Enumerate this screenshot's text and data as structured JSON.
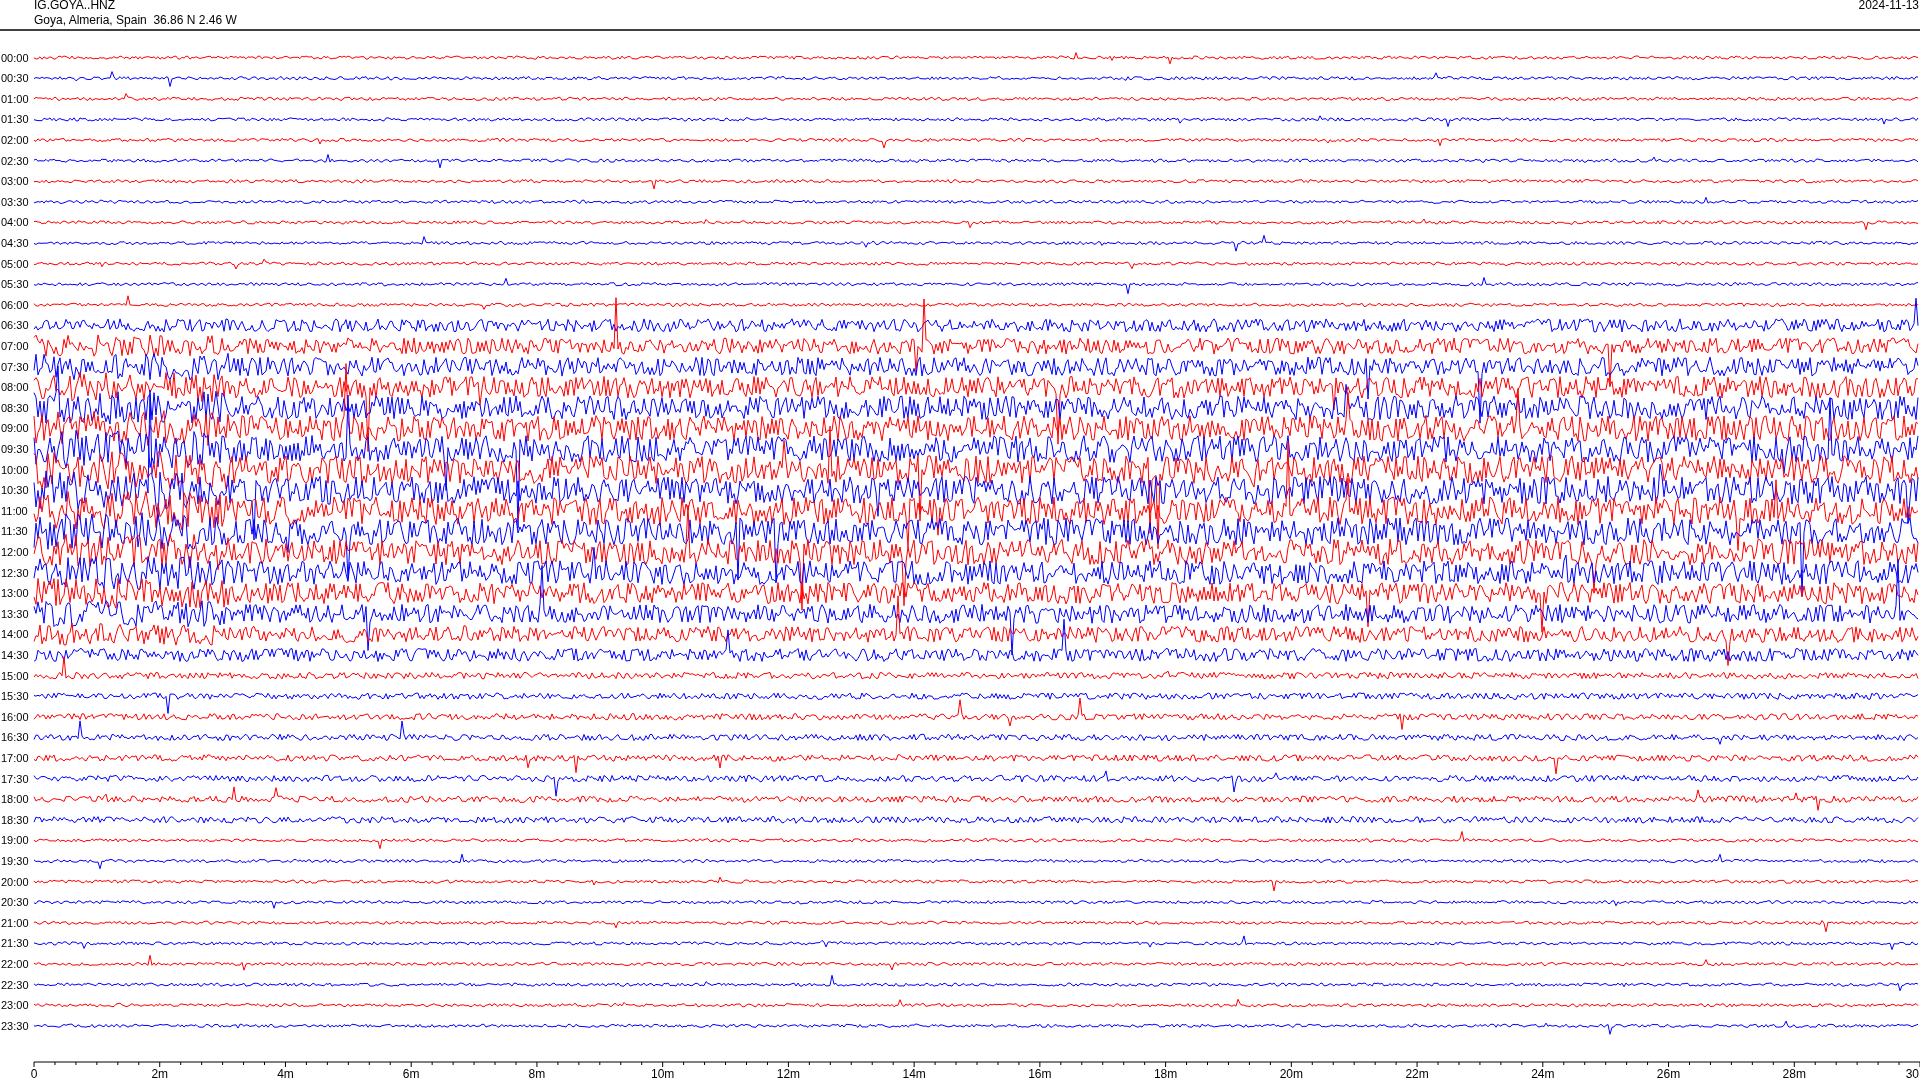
{
  "header": {
    "station": "IG.GOYA..HNZ",
    "location": "Goya, Almeria, Spain  36.86 N 2.46 W",
    "date": "2024-11-13"
  },
  "rows": [
    {
      "label": "00:00",
      "color": "#ff0000"
    },
    {
      "label": "00:30",
      "color": "#0000ff"
    },
    {
      "label": "01:00",
      "color": "#ff0000"
    },
    {
      "label": "01:30",
      "color": "#0000ff"
    },
    {
      "label": "02:00",
      "color": "#ff0000"
    },
    {
      "label": "02:30",
      "color": "#0000ff"
    },
    {
      "label": "03:00",
      "color": "#ff0000"
    },
    {
      "label": "03:30",
      "color": "#0000ff"
    },
    {
      "label": "04:00",
      "color": "#ff0000"
    },
    {
      "label": "04:30",
      "color": "#0000ff"
    },
    {
      "label": "05:00",
      "color": "#ff0000"
    },
    {
      "label": "05:30",
      "color": "#0000ff"
    },
    {
      "label": "06:00",
      "color": "#ff0000"
    },
    {
      "label": "06:30",
      "color": "#0000ff"
    },
    {
      "label": "07:00",
      "color": "#ff0000"
    },
    {
      "label": "07:30",
      "color": "#0000ff"
    },
    {
      "label": "08:00",
      "color": "#ff0000"
    },
    {
      "label": "08:30",
      "color": "#0000ff"
    },
    {
      "label": "09:00",
      "color": "#ff0000"
    },
    {
      "label": "09:30",
      "color": "#0000ff"
    },
    {
      "label": "10:00",
      "color": "#ff0000"
    },
    {
      "label": "10:30",
      "color": "#0000ff"
    },
    {
      "label": "11:00",
      "color": "#ff0000"
    },
    {
      "label": "11:30",
      "color": "#0000ff"
    },
    {
      "label": "12:00",
      "color": "#ff0000"
    },
    {
      "label": "12:30",
      "color": "#0000ff"
    },
    {
      "label": "13:00",
      "color": "#ff0000"
    },
    {
      "label": "13:30",
      "color": "#0000ff"
    },
    {
      "label": "14:00",
      "color": "#ff0000"
    },
    {
      "label": "14:30",
      "color": "#0000ff"
    },
    {
      "label": "15:00",
      "color": "#ff0000"
    },
    {
      "label": "15:30",
      "color": "#0000ff"
    },
    {
      "label": "16:00",
      "color": "#ff0000"
    },
    {
      "label": "16:30",
      "color": "#0000ff"
    },
    {
      "label": "17:00",
      "color": "#ff0000"
    },
    {
      "label": "17:30",
      "color": "#0000ff"
    },
    {
      "label": "18:00",
      "color": "#ff0000"
    },
    {
      "label": "18:30",
      "color": "#0000ff"
    },
    {
      "label": "19:00",
      "color": "#ff0000"
    },
    {
      "label": "19:30",
      "color": "#0000ff"
    },
    {
      "label": "20:00",
      "color": "#ff0000"
    },
    {
      "label": "20:30",
      "color": "#0000ff"
    },
    {
      "label": "21:00",
      "color": "#ff0000"
    },
    {
      "label": "21:30",
      "color": "#0000ff"
    },
    {
      "label": "22:00",
      "color": "#ff0000"
    },
    {
      "label": "22:30",
      "color": "#0000ff"
    },
    {
      "label": "23:00",
      "color": "#ff0000"
    },
    {
      "label": "23:30",
      "color": "#0000ff"
    }
  ],
  "x_axis": {
    "ticks": [
      "0",
      "2m",
      "4m",
      "6m",
      "8m",
      "10m",
      "12m",
      "14m",
      "16m",
      "18m",
      "20m",
      "22m",
      "24m",
      "26m",
      "28m",
      "30"
    ]
  }
}
